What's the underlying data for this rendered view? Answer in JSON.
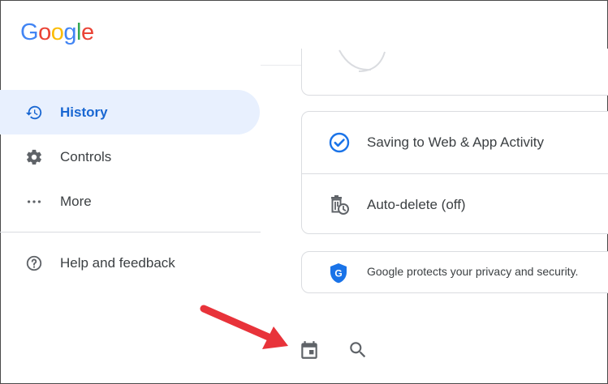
{
  "logo": {
    "letters": [
      "G",
      "o",
      "o",
      "g",
      "l",
      "e"
    ]
  },
  "sidebar": {
    "items": [
      {
        "label": "History",
        "icon": "history-icon",
        "active": true
      },
      {
        "label": "Controls",
        "icon": "gear-icon",
        "active": false
      },
      {
        "label": "More",
        "icon": "more-horiz-icon",
        "active": false
      },
      {
        "label": "Help and feedback",
        "icon": "help-icon",
        "active": false
      }
    ]
  },
  "main": {
    "activity_rows": [
      {
        "label": "Saving to Web & App Activity",
        "icon": "check-circle-icon"
      },
      {
        "label": "Auto-delete (off)",
        "icon": "auto-delete-icon"
      }
    ],
    "privacy_notice": {
      "label": "Google protects your privacy and security.",
      "icon": "google-shield-icon"
    }
  },
  "toolbar": {
    "calendar_icon": "calendar-icon",
    "search_icon": "search-icon"
  },
  "colors": {
    "accent": "#1967d2",
    "active_bg": "#e8f0fe",
    "arrow": "#e8333a"
  }
}
